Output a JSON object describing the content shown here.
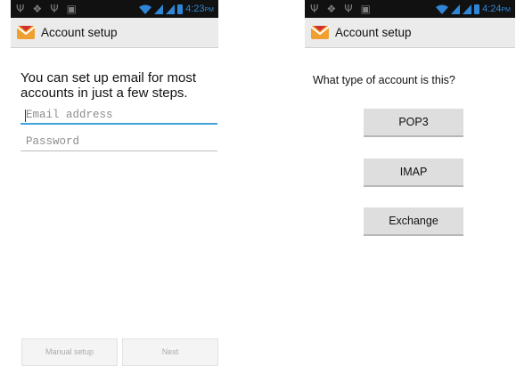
{
  "left_screen": {
    "status": {
      "time": "4:23",
      "ampm": "PM"
    },
    "action_bar": {
      "title": "Account setup",
      "icon": "email-envelope-icon"
    },
    "intro_text": "You can set up email for most accounts in just a few steps.",
    "email_field": {
      "placeholder": "Email address"
    },
    "password_field": {
      "placeholder": "Password"
    },
    "buttons": {
      "manual_setup": "Manual setup",
      "next": "Next"
    }
  },
  "right_screen": {
    "status": {
      "time": "4:24",
      "ampm": "PM"
    },
    "action_bar": {
      "title": "Account setup",
      "icon": "email-envelope-icon"
    },
    "question": "What type of account is this?",
    "account_types": [
      "POP3",
      "IMAP",
      "Exchange"
    ]
  },
  "colors": {
    "status_blue": "#2f86d6",
    "status_bar": "#111111",
    "action_bar": "#ebebeb",
    "focus_underline": "#43a4dc",
    "app_icon_orange": "#f0a030"
  }
}
